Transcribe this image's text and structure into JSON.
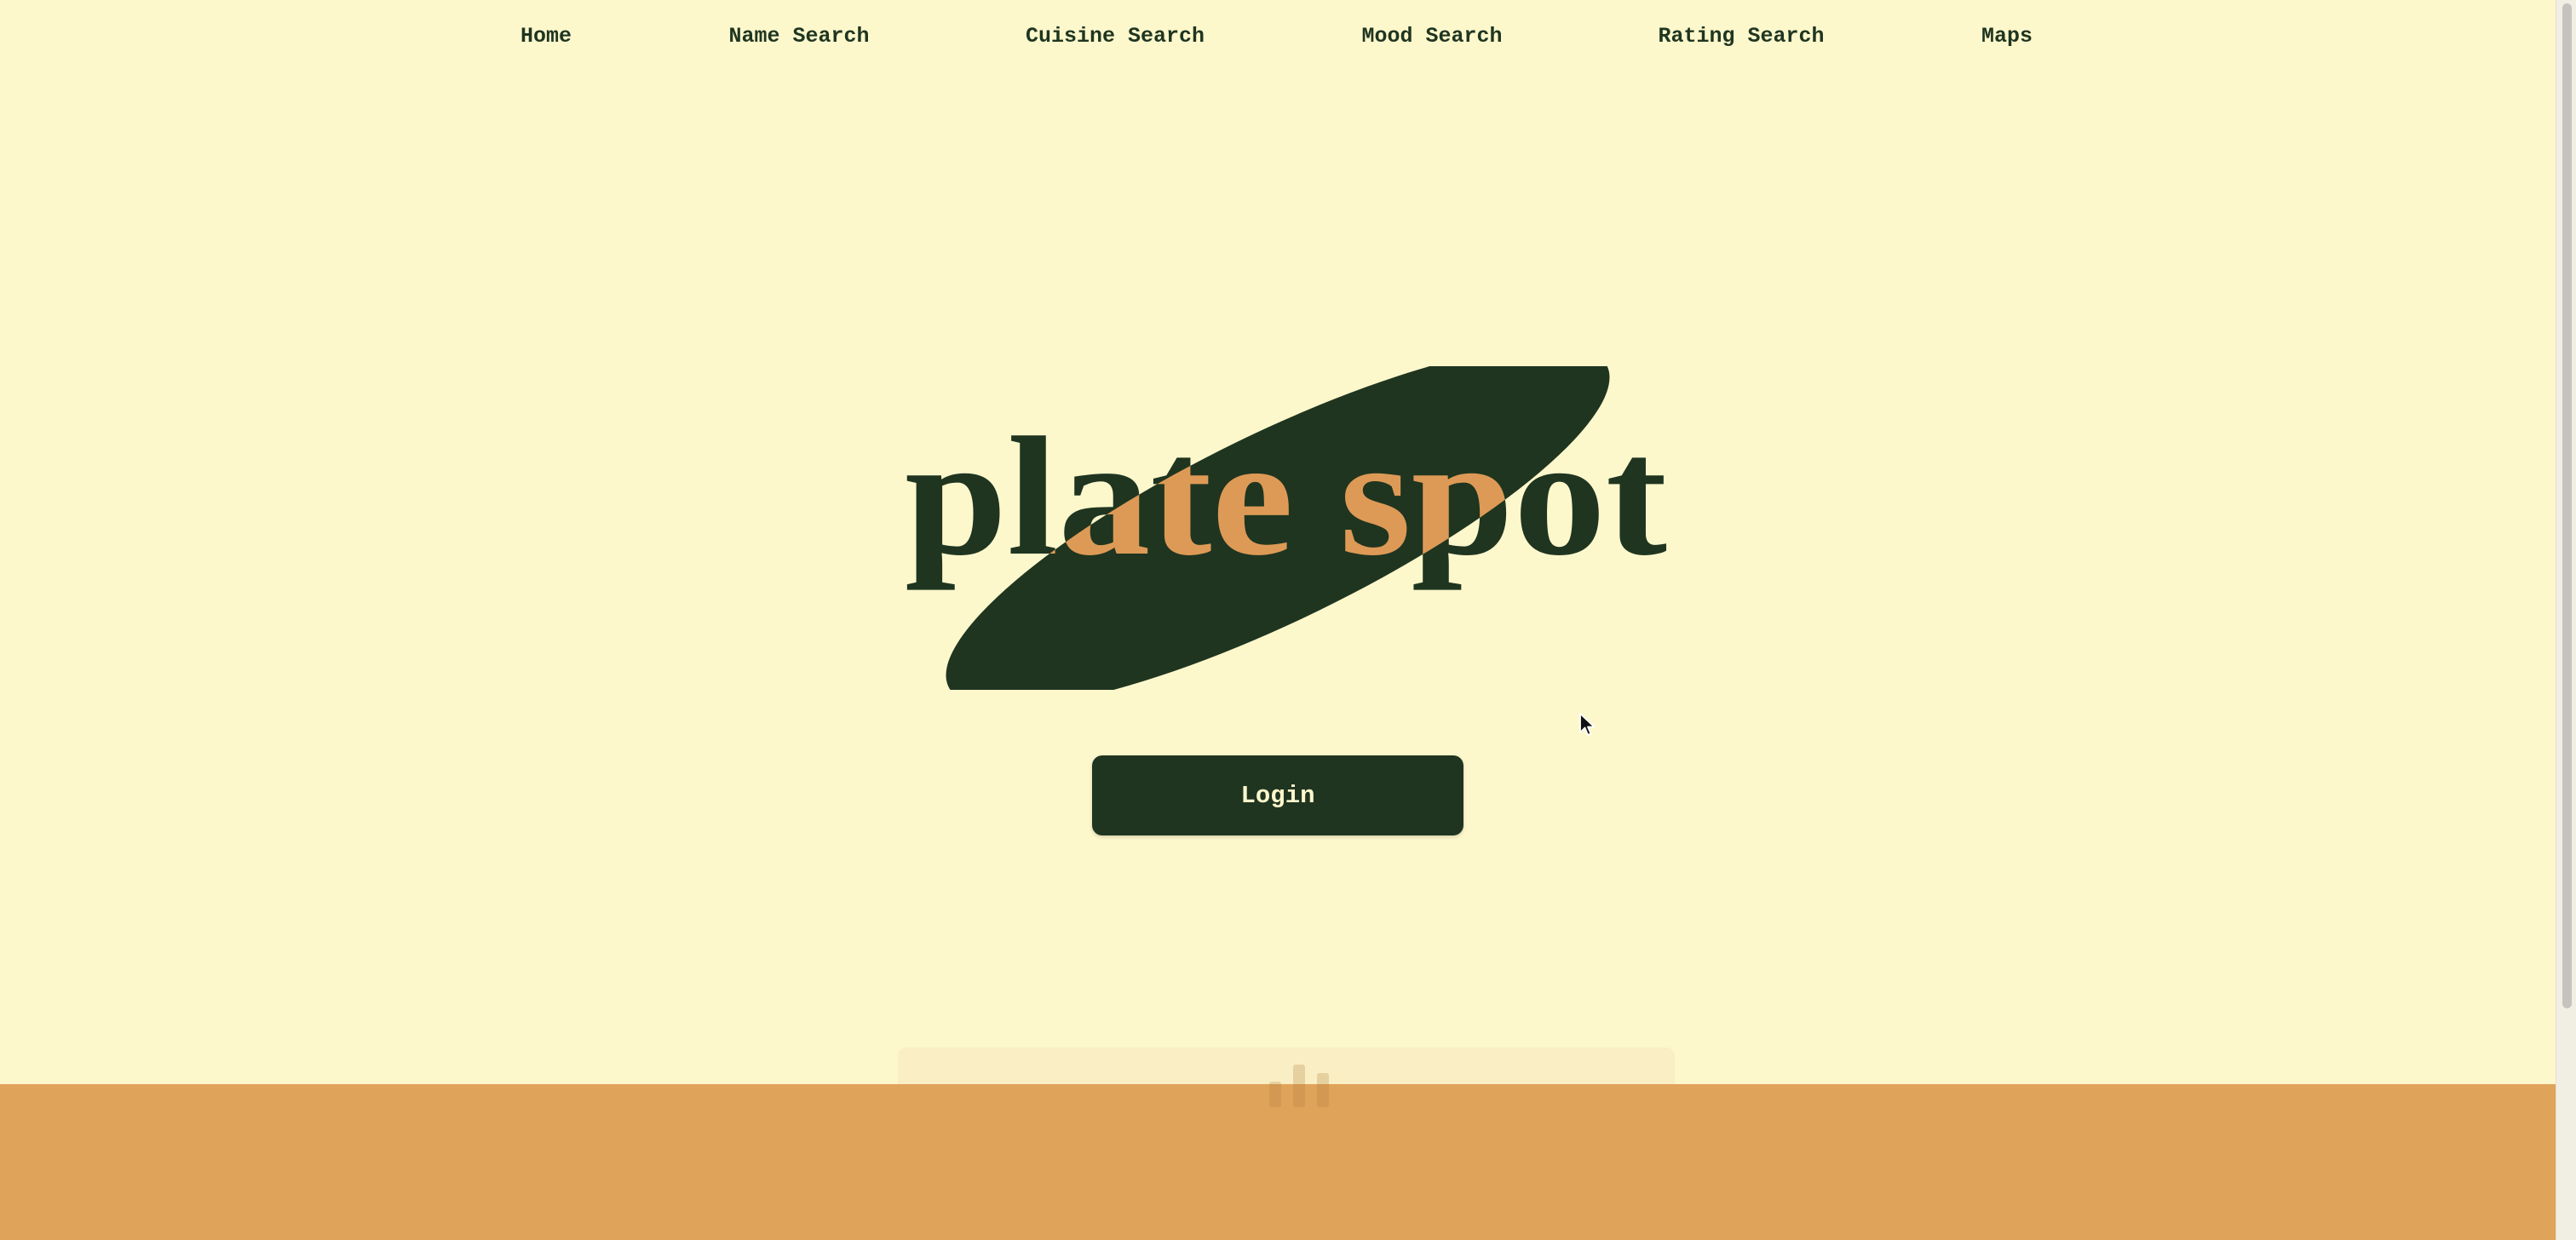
{
  "nav": {
    "items": [
      {
        "label": "Home"
      },
      {
        "label": "Name Search"
      },
      {
        "label": "Cuisine Search"
      },
      {
        "label": "Mood Search"
      },
      {
        "label": "Rating Search"
      },
      {
        "label": "Maps"
      }
    ]
  },
  "logo": {
    "text": "plate spot",
    "colors": {
      "ellipse": "#1f3520",
      "letters": "#1f3520",
      "letters_on_ellipse": "#dd9a56"
    }
  },
  "login": {
    "label": "Login"
  },
  "colors": {
    "background": "#fdf7cc",
    "primary_dark": "#1f3520",
    "accent_orange": "#e0a35a"
  }
}
